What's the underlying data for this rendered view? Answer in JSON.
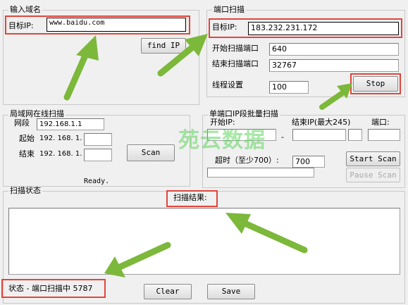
{
  "domain_input": {
    "title": "输入域名",
    "target_ip_label": "目标IP:",
    "domain_value": "www.baidu.com",
    "find_ip_button": "find IP"
  },
  "port_scan": {
    "title": "端口扫描",
    "target_ip_label": "目标IP:",
    "target_ip_value": "183.232.231.172",
    "start_port_label": "开始扫描端口",
    "start_port_value": "640",
    "end_port_label": "结束扫描端口",
    "end_port_value": "32767",
    "thread_label": "线程设置",
    "thread_value": "100",
    "stop_button": "Stop"
  },
  "lan_scan": {
    "title": "局域网在线扫描",
    "network_label": "网段",
    "network_value": "192.168.1.1",
    "start_label": "起始",
    "start_prefix": "192. 168. 1.",
    "start_value": "",
    "end_label": "结束",
    "end_prefix": "192. 168. 1.",
    "end_value": "",
    "scan_button": "Scan",
    "ready_text": "Ready."
  },
  "batch_scan": {
    "title": "单端口IP段批量扫描",
    "start_ip_label": "开始IP:",
    "dash": "-",
    "end_ip_label": "结束IP(最大245)",
    "port_label": "端口:",
    "timeout_label": "超时（至少700）:",
    "timeout_value": "700",
    "start_scan_button": "Start Scan",
    "pause_scan_button": "Pause Scan"
  },
  "scan_status": {
    "title": "扫描状态",
    "result_label": "扫描结果:",
    "status_text": "状态 - 端口扫描中 5787",
    "clear_button": "Clear",
    "save_button": "Save"
  },
  "watermark": "苑云数据",
  "colors": {
    "highlight_red": "#e0463c",
    "arrow_green": "#7cb83a",
    "window_bg": "#f0f0f0"
  }
}
